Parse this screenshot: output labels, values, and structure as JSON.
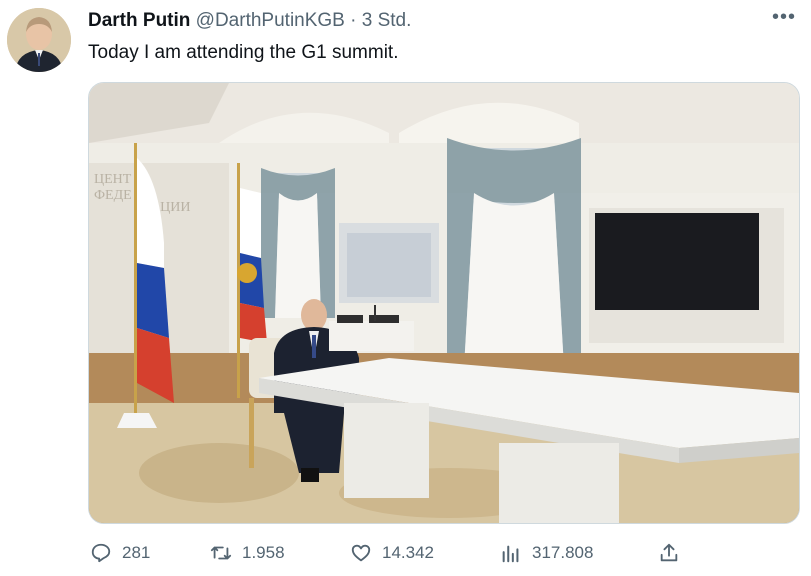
{
  "tweet": {
    "author_name": "Darth Putin",
    "handle": "@DarthPutinKGB",
    "separator": " · ",
    "time": "3 Std.",
    "text": "Today I am attending the G1 summit.",
    "more_label": "•••",
    "media": {
      "wall_sign_line1": "ЦЕНТ",
      "wall_sign_line2": "ФЕДЕ",
      "wall_sign_line3": "РАЦИИ"
    },
    "stats": {
      "replies": "281",
      "retweets": "1.958",
      "likes": "14.342",
      "views": "317.808"
    }
  },
  "icons": {
    "reply": "reply-icon",
    "retweet": "retweet-icon",
    "like": "heart-icon",
    "views": "views-icon",
    "share": "share-icon",
    "more": "more-icon"
  },
  "colors": {
    "muted": "#536471",
    "text": "#0f1419",
    "border": "#cfd9de"
  }
}
